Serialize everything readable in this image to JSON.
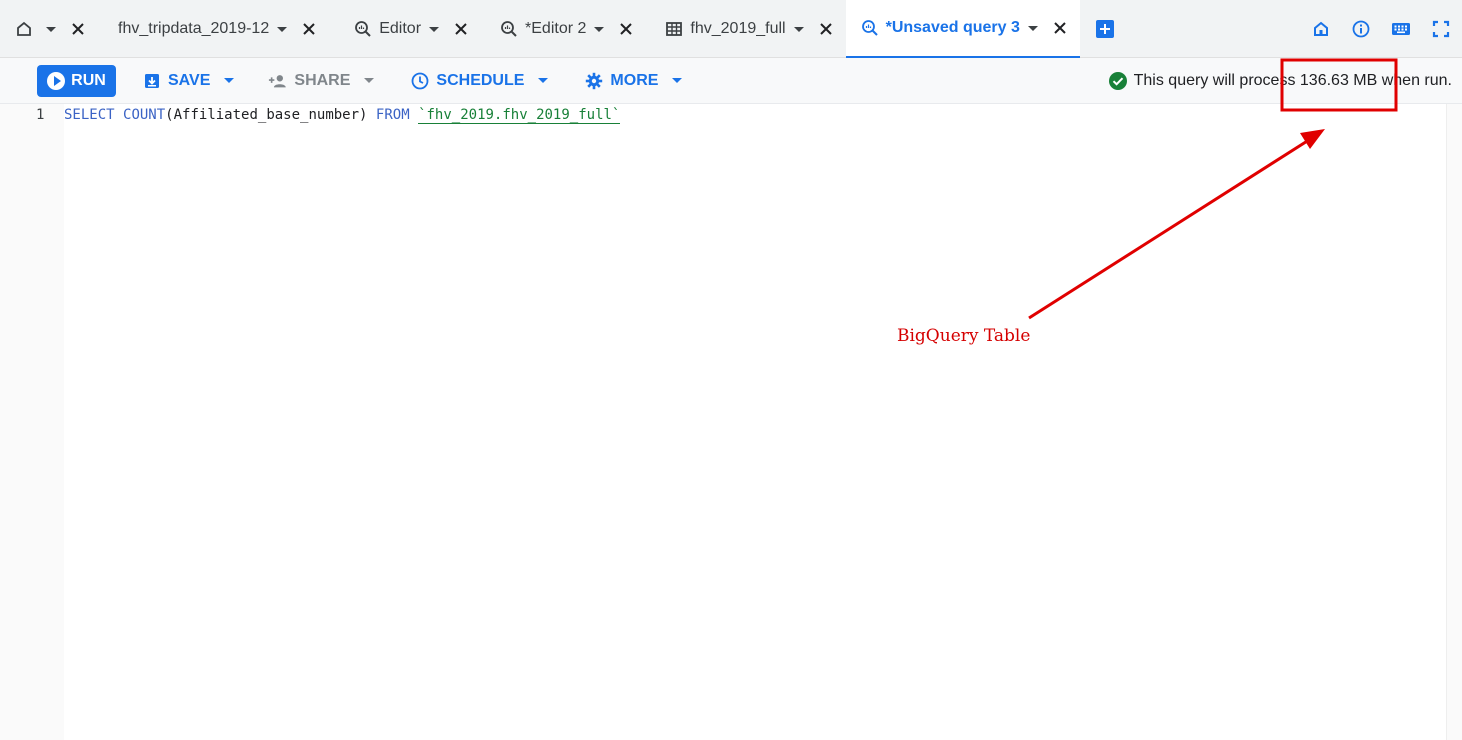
{
  "tabs": [
    {
      "label": "",
      "icon": "home-icon",
      "type": "home"
    },
    {
      "label": "fhv_tripdata_2019-12",
      "icon": ""
    },
    {
      "label": "Editor",
      "icon": "query-icon"
    },
    {
      "label": "*Editor 2",
      "icon": "query-icon"
    },
    {
      "label": "fhv_2019_full",
      "icon": "table-icon"
    },
    {
      "label": "*Unsaved query 3",
      "icon": "query-icon",
      "active": true
    }
  ],
  "toolbar": {
    "run_label": "RUN",
    "save_label": "SAVE",
    "share_label": "SHARE",
    "schedule_label": "SCHEDULE",
    "more_label": "MORE"
  },
  "status": {
    "message": "This query will process 136.63 MB when run."
  },
  "editor": {
    "line_number": "1",
    "kw_select": "SELECT",
    "fn_count": "COUNT",
    "args": "(Affiliated_base_number)",
    "kw_from": "FROM",
    "table_ref": "`fhv_2019.fhv_2019_full`"
  },
  "annotation": {
    "label": "BigQuery Table",
    "color": "#e00000"
  },
  "colors": {
    "accent": "#1a73e8",
    "success": "#188038",
    "annotation": "#e00000"
  }
}
